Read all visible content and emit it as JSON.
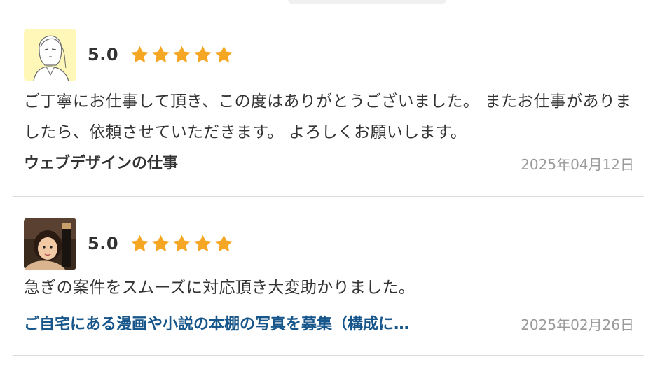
{
  "reviews": [
    {
      "score": "5.0",
      "rating": 5,
      "avatar_icon": "woman-sketch-avatar",
      "comment": "ご丁寧にお仕事して頂き、この度はありがとうございました。 またお仕事がありましたら、依頼させていただきます。 よろしくお願いします。",
      "job_title": "ウェブデザインの仕事",
      "date": "2025年04月12日"
    },
    {
      "score": "5.0",
      "rating": 5,
      "avatar_icon": "woman-photo-avatar",
      "comment": "急ぎの案件をスムーズに対応頂き大変助かりました。",
      "job_title": "ご自宅にある漫画や小説の本棚の写真を募集（構成に…",
      "date": "2025年02月26日"
    }
  ],
  "colors": {
    "star": "#f5a623",
    "link": "#17568a",
    "date": "#9a9a9a",
    "divider": "#dcdcdc"
  }
}
